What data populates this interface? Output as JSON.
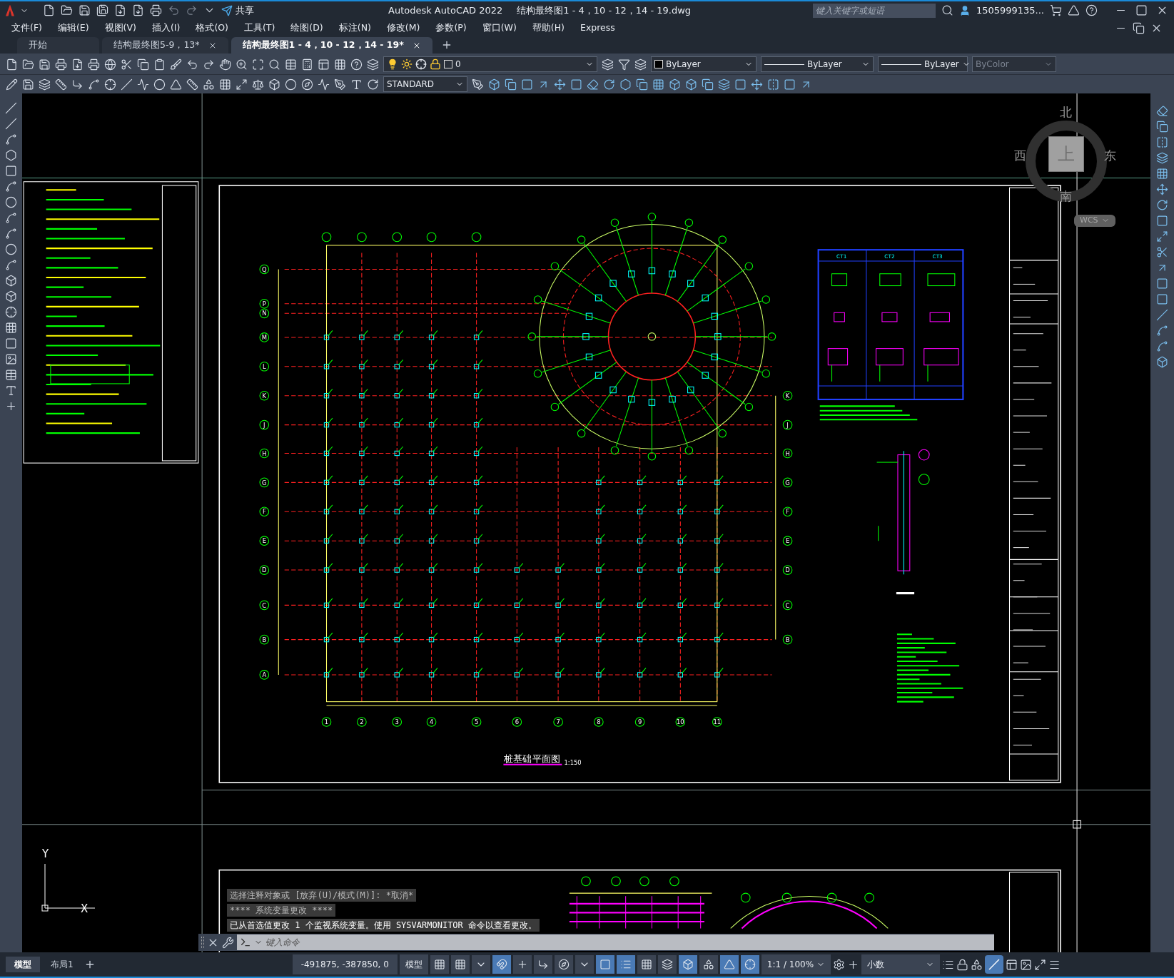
{
  "title_bar": {
    "app": "Autodesk AutoCAD 2022",
    "file": "结构最终图1 - 4，10 - 12，14 - 19.dwg",
    "share": "共享",
    "search_placeholder": "键入关键字或短语",
    "user": "1505999135..."
  },
  "menu": [
    "文件(F)",
    "编辑(E)",
    "视图(V)",
    "插入(I)",
    "格式(O)",
    "工具(T)",
    "绘图(D)",
    "标注(N)",
    "修改(M)",
    "参数(P)",
    "窗口(W)",
    "帮助(H)",
    "Express"
  ],
  "doc_tabs": [
    {
      "label": "开始",
      "selected": false,
      "closable": false
    },
    {
      "label": "结构最终图5-9，13*",
      "selected": false,
      "closable": true
    },
    {
      "label": "结构最终图1 - 4，10 - 12，14 - 19*",
      "selected": true,
      "closable": true
    }
  ],
  "toolbar": {
    "layer": "0",
    "color_control": "ByLayer",
    "linetype": "ByLayer",
    "lineweight": "ByLayer",
    "plot_style": {
      "value": "ByColor",
      "disabled": true
    },
    "text_style": "STANDARD"
  },
  "viewcube": {
    "north": "北",
    "south": "南",
    "east": "东",
    "west": "西",
    "face": "上",
    "ucs": "WCS"
  },
  "ucs_icon": {
    "x": "X",
    "y": "Y"
  },
  "drawing": {
    "title": "桩基础平面图",
    "scale": "1:150",
    "columns": [
      "1",
      "2",
      "3",
      "4",
      "5",
      "6",
      "7",
      "8",
      "9",
      "10",
      "11"
    ],
    "rows_left": [
      "Q",
      "P",
      "N",
      "M",
      "L",
      "K",
      "J",
      "H",
      "G",
      "F",
      "E",
      "D",
      "C",
      "B",
      "A"
    ],
    "rows_right": [
      "K",
      "J",
      "H",
      "G",
      "F",
      "E",
      "D",
      "C",
      "B"
    ],
    "table_headers": [
      "CT1",
      "CT2",
      "CT3"
    ]
  },
  "command_line": {
    "history": [
      "选择注释对象或 [放弃(U)/模式(M)]: *取消*",
      "**** 系统变量更改 ****",
      "已从首选值更改 1 个监视系统变量。使用 SYSVARMONITOR 命令以查看更改。"
    ],
    "placeholder": "键入命令"
  },
  "layout_tabs": [
    {
      "label": "模型",
      "selected": true
    },
    {
      "label": "布局1",
      "selected": false
    }
  ],
  "status_bar": {
    "coordinates": "-491875, -387850, 0",
    "space": "模型",
    "annotation_scale": "1:1 / 100%",
    "units": "小数"
  },
  "status_toggles": [
    {
      "on": false
    },
    {
      "on": false
    },
    {
      "on": false
    },
    {
      "on": true
    },
    {
      "on": false
    },
    {
      "on": false
    },
    {
      "on": false
    },
    {
      "on": false
    },
    {
      "on": true
    },
    {
      "on": true
    },
    {
      "on": false
    },
    {
      "on": false
    },
    {
      "on": true
    },
    {
      "on": false
    },
    {
      "on": true
    },
    {
      "on": true
    }
  ]
}
